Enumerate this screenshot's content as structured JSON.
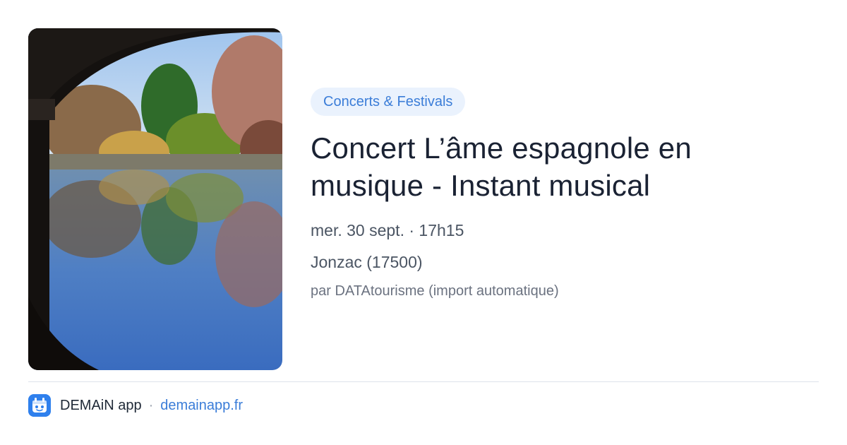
{
  "event": {
    "category": "Concerts & Festivals",
    "title_line1": "Concert L’âme espagnole en",
    "title_line2": "musique - Instant musical",
    "date": "mer. 30 sept. · 17h15",
    "location": "Jonzac (17500)",
    "source": "par DATAtourisme (import automatique)"
  },
  "footer": {
    "app_name": "DEMAiN app",
    "separator": "·",
    "link": "demainapp.fr"
  },
  "colors": {
    "accent": "#3b7dd8",
    "badge_bg": "#eaf2fd",
    "logo_bg": "#2f80ed"
  },
  "icons": {
    "app_logo": "demain-logo-icon"
  }
}
